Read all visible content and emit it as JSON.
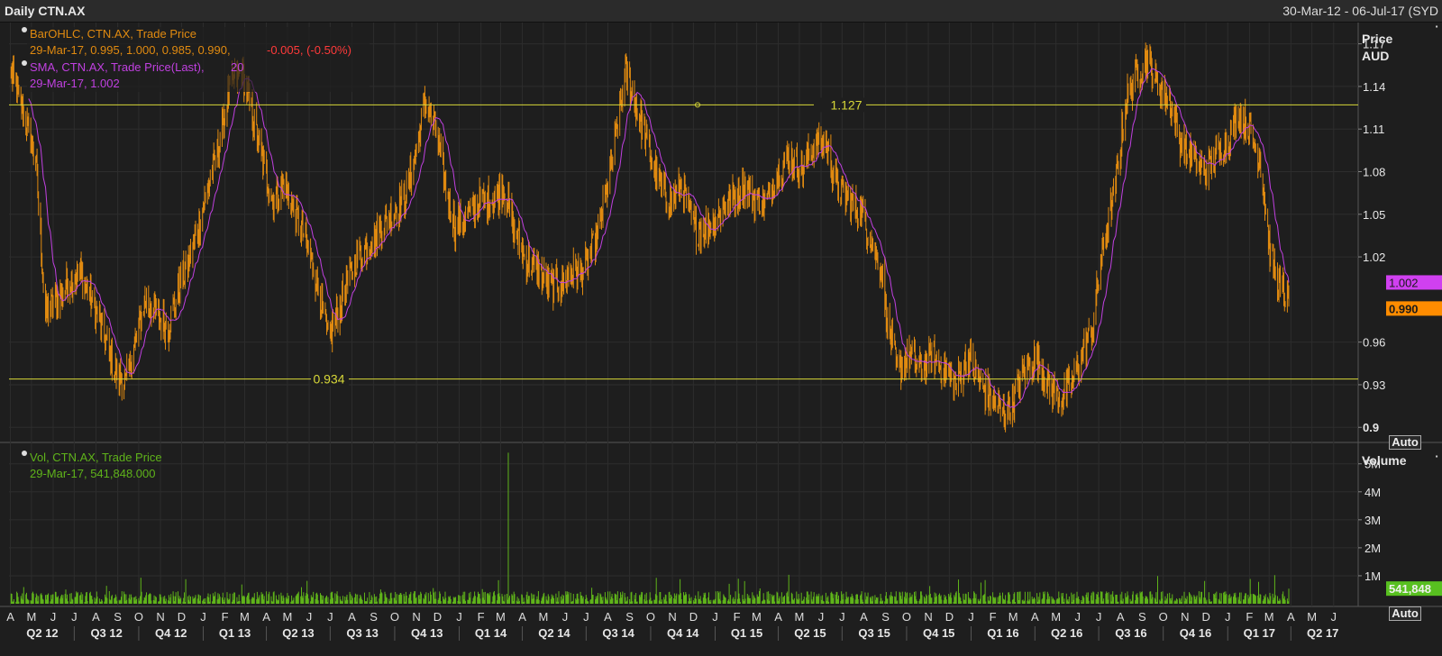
{
  "window": {
    "title": "Daily CTN.AX",
    "date_range": "30-Mar-12 - 06-Jul-17 (SYD"
  },
  "price_panel": {
    "legend": {
      "ohlc_name": "BarOHLC, CTN.AX, Trade Price",
      "ohlc_date_values": "29-Mar-17, 0.995, 1.000, 0.985, 0.990,",
      "ohlc_change": "-0.005, (-0.50%)",
      "sma_name": "SMA, CTN.AX, Trade Price(Last),",
      "sma_period": "20",
      "sma_value": "29-Mar-17, 1.002"
    },
    "axis_title_1": "Price",
    "axis_title_2": "AUD",
    "ticks": [
      "1.17",
      "1.14",
      "1.11",
      "1.08",
      "1.05",
      "1.02",
      "0.96",
      "0.93",
      "0.9"
    ],
    "bold_tick": "0.9",
    "tag_sma": "1.002",
    "tag_last": "0.990",
    "hline_high": "1.127",
    "hline_low": "0.934",
    "auto_label": "Auto"
  },
  "volume_panel": {
    "legend": {
      "name": "Vol, CTN.AX, Trade Price",
      "value": "29-Mar-17, 541,848.000"
    },
    "axis_title": "Volume",
    "ticks": [
      "5M",
      "4M",
      "3M",
      "2M",
      "1M"
    ],
    "tag_last": "541,848",
    "auto_label": "Auto"
  },
  "x_axis": {
    "months": [
      "A",
      "M",
      "J",
      "J",
      "A",
      "S",
      "O",
      "N",
      "D",
      "J",
      "F",
      "M",
      "A",
      "M",
      "J",
      "J",
      "A",
      "S",
      "O",
      "N",
      "D",
      "J",
      "F",
      "M",
      "A",
      "M",
      "J",
      "J",
      "A",
      "S",
      "O",
      "N",
      "D",
      "J",
      "F",
      "M",
      "A",
      "M",
      "J",
      "J",
      "A",
      "S",
      "O",
      "N",
      "D",
      "J",
      "F",
      "M",
      "A",
      "M",
      "J",
      "J",
      "A",
      "S",
      "O",
      "N",
      "D",
      "J",
      "F",
      "M",
      "A",
      "M",
      "J"
    ],
    "quarters": [
      "Q2 12",
      "Q3 12",
      "Q4 12",
      "Q1 13",
      "Q2 13",
      "Q3 13",
      "Q4 13",
      "Q1 14",
      "Q2 14",
      "Q3 14",
      "Q4 14",
      "Q1 15",
      "Q2 15",
      "Q3 15",
      "Q4 15",
      "Q1 16",
      "Q2 16",
      "Q3 16",
      "Q4 16",
      "Q1 17",
      "Q2 17"
    ]
  },
  "colors": {
    "bars": "#e08a10",
    "sma": "#c040e0",
    "volume": "#5fb31a",
    "hline": "#d8d838",
    "tag_sma_bg": "#d040f0",
    "tag_last_bg": "#ff8c00",
    "tag_vol_bg": "#58c020",
    "neg": "#ff3a3a",
    "background": "#1e1e1e",
    "grid": "#2d2d2d"
  },
  "chart_data": {
    "type": "ohlc",
    "symbol": "CTN.AX",
    "x_range": [
      "2012-03-30",
      "2017-07-06"
    ],
    "price_ylim": [
      0.89,
      1.185
    ],
    "volume_ylim": [
      0,
      5700000
    ],
    "last_bar": {
      "date": "2017-03-29",
      "open": 0.995,
      "high": 1.0,
      "low": 0.985,
      "close": 0.99,
      "change": -0.005,
      "change_pct": -0.5,
      "sma20": 1.002,
      "volume": 541848
    },
    "hlines": [
      1.127,
      0.934
    ],
    "close_path": {
      "dates": [
        "2012-04-02",
        "2012-04-20",
        "2012-05-07",
        "2012-05-21",
        "2012-06-05",
        "2012-06-20",
        "2012-07-09",
        "2012-07-25",
        "2012-08-10",
        "2012-08-27",
        "2012-09-12",
        "2012-09-26",
        "2012-10-10",
        "2012-10-26",
        "2012-11-12",
        "2012-11-28",
        "2012-12-14",
        "2013-01-03",
        "2013-01-24",
        "2013-02-08",
        "2013-02-25",
        "2013-03-12",
        "2013-03-25",
        "2013-04-10",
        "2013-04-26",
        "2013-05-13",
        "2013-05-28",
        "2013-06-13",
        "2013-06-28",
        "2013-07-08",
        "2013-07-24",
        "2013-08-08",
        "2013-08-26",
        "2013-09-12",
        "2013-09-27",
        "2013-10-15",
        "2013-10-30",
        "2013-11-14",
        "2013-11-28",
        "2013-12-12",
        "2013-12-27",
        "2014-01-14",
        "2014-01-31",
        "2014-02-18",
        "2014-03-05",
        "2014-03-20",
        "2014-04-04",
        "2014-04-22",
        "2014-05-07",
        "2014-05-22",
        "2014-06-09",
        "2014-06-25",
        "2014-07-14",
        "2014-07-28",
        "2014-08-11",
        "2014-08-26",
        "2014-09-08",
        "2014-09-26",
        "2014-10-13",
        "2014-10-30",
        "2014-11-14",
        "2014-12-02",
        "2014-12-17",
        "2015-01-06",
        "2015-01-23",
        "2015-02-10",
        "2015-02-27",
        "2015-03-16",
        "2015-04-01",
        "2015-04-17",
        "2015-05-05",
        "2015-05-21",
        "2015-06-08",
        "2015-06-24",
        "2015-07-10",
        "2015-07-28",
        "2015-08-13",
        "2015-08-27",
        "2015-09-02",
        "2015-09-17",
        "2015-10-05",
        "2015-10-21",
        "2015-11-06",
        "2015-11-24",
        "2015-12-10",
        "2015-12-28",
        "2016-01-14",
        "2016-01-29",
        "2016-02-15",
        "2016-03-02",
        "2016-03-17",
        "2016-04-04",
        "2016-04-20",
        "2016-05-05",
        "2016-05-23",
        "2016-06-07",
        "2016-06-22",
        "2016-07-08",
        "2016-07-25",
        "2016-08-09",
        "2016-08-24",
        "2016-09-08",
        "2016-09-23",
        "2016-10-10",
        "2016-10-26",
        "2016-11-10",
        "2016-11-28",
        "2016-12-13",
        "2016-12-30",
        "2017-01-16",
        "2017-01-31",
        "2017-02-16",
        "2017-03-03",
        "2017-03-14",
        "2017-03-29"
      ],
      "values": [
        1.15,
        1.12,
        1.09,
        0.98,
        0.99,
        1.0,
        1.01,
        0.99,
        0.97,
        0.94,
        0.93,
        0.96,
        0.99,
        0.98,
        0.97,
        1.0,
        1.02,
        1.06,
        1.1,
        1.14,
        1.15,
        1.12,
        1.09,
        1.06,
        1.07,
        1.05,
        1.03,
        1.0,
        0.96,
        0.975,
        1.0,
        1.02,
        1.03,
        1.04,
        1.05,
        1.06,
        1.09,
        1.13,
        1.11,
        1.07,
        1.04,
        1.05,
        1.06,
        1.06,
        1.07,
        1.04,
        1.02,
        1.01,
        1.0,
        1.0,
        1.01,
        1.01,
        1.03,
        1.06,
        1.1,
        1.15,
        1.13,
        1.1,
        1.07,
        1.06,
        1.07,
        1.04,
        1.04,
        1.05,
        1.06,
        1.07,
        1.06,
        1.06,
        1.08,
        1.09,
        1.08,
        1.1,
        1.1,
        1.07,
        1.06,
        1.05,
        1.03,
        1.01,
        0.98,
        0.94,
        0.95,
        0.94,
        0.95,
        0.94,
        0.93,
        0.95,
        0.93,
        0.92,
        0.91,
        0.92,
        0.94,
        0.95,
        0.93,
        0.92,
        0.93,
        0.95,
        0.97,
        1.03,
        1.07,
        1.13,
        1.15,
        1.16,
        1.14,
        1.13,
        1.1,
        1.09,
        1.08,
        1.09,
        1.1,
        1.12,
        1.11,
        1.09,
        1.02,
        1.0,
        0.99
      ]
    },
    "volume_spike": {
      "date": "2014-03-12",
      "value": 5400000
    },
    "typical_volume": 300000
  }
}
